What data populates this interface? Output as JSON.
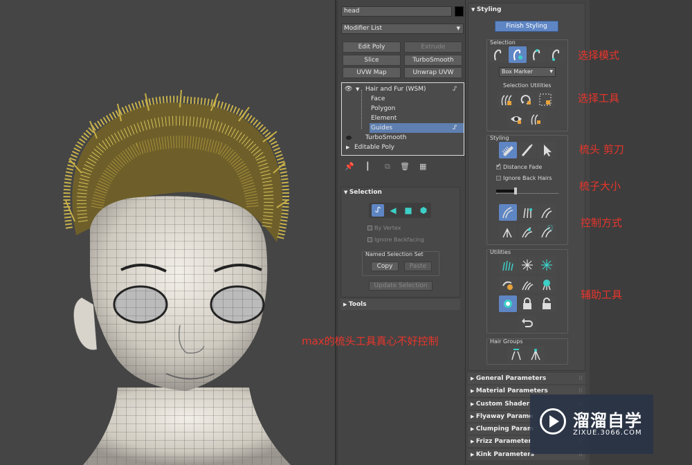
{
  "object_name": "head",
  "modifier_list_label": "Modifier List",
  "modifier_buttons": [
    {
      "label": "Edit Poly",
      "enabled": true
    },
    {
      "label": "Extrude",
      "enabled": false
    },
    {
      "label": "Slice",
      "enabled": true
    },
    {
      "label": "TurboSmooth",
      "enabled": true
    },
    {
      "label": "UVW Map",
      "enabled": true
    },
    {
      "label": "Unwrap UVW",
      "enabled": true
    }
  ],
  "stack": [
    {
      "label": "Hair and Fur (WSM)",
      "level": 0,
      "selected": false
    },
    {
      "label": "Face",
      "level": 1,
      "selected": false
    },
    {
      "label": "Polygon",
      "level": 1,
      "selected": false
    },
    {
      "label": "Element",
      "level": 1,
      "selected": false
    },
    {
      "label": "Guides",
      "level": 1,
      "selected": true
    },
    {
      "label": "TurboSmooth",
      "level": 0,
      "selected": false
    },
    {
      "label": "Editable Poly",
      "level": 0,
      "selected": false
    }
  ],
  "selection_rollout": {
    "title": "Selection",
    "by_vertex": "By Vertex",
    "ignore_backfacing": "Ignore Backfacing",
    "named_selection_set": "Named Selection Set",
    "copy": "Copy",
    "paste": "Paste",
    "update_selection": "Update Selection"
  },
  "tools_rollout": {
    "title": "Tools"
  },
  "styling": {
    "title": "Styling",
    "finish_button": "Finish Styling",
    "selection_label": "Selection",
    "dropdown_value": "Box Marker",
    "selection_utilities_label": "Selection Utilities",
    "styling_label": "Styling",
    "distance_fade": "Distance Fade",
    "ignore_back_hairs": "Ignore Back Hairs",
    "utilities_label": "Utilities",
    "hair_groups_label": "Hair Groups"
  },
  "collapsed_rollouts": [
    "General Parameters",
    "Material Parameters",
    "Custom Shader",
    "Flyaway Parame",
    "Clumping Param",
    "Frizz Parameter",
    "Kink Parameters"
  ],
  "annotations": {
    "selection_mode": "选择模式",
    "selection_tools": "选择工具",
    "comb_cut": "梳头 剪刀",
    "brush_size": "梳子大小",
    "control_mode": "控制方式",
    "helper_tools": "辅助工具",
    "comment": "max的梳头工具真心不好控制"
  },
  "watermark": {
    "title": "溜溜自学",
    "url": "ZIXUE.3066.COM"
  },
  "colors": {
    "highlight": "#5e7fb0",
    "annotation": "#e8352b",
    "hair": "#b8a23a"
  }
}
